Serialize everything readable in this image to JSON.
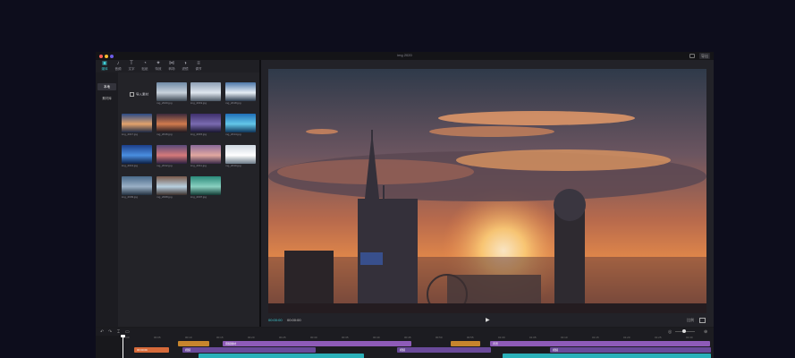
{
  "window": {
    "title": "img 2020",
    "traffic_lights": [
      "#ff5f57",
      "#febc2e",
      "#6c5ce7"
    ],
    "export_label": "导出"
  },
  "tabs": [
    {
      "icon": "media-icon",
      "glyph": "▣",
      "label": "媒体",
      "active": true
    },
    {
      "icon": "audio-icon",
      "glyph": "♪",
      "label": "音频",
      "active": false
    },
    {
      "icon": "text-icon",
      "glyph": "T",
      "label": "文字",
      "active": false
    },
    {
      "icon": "sticker-icon",
      "glyph": "◔",
      "label": "贴纸",
      "active": false
    },
    {
      "icon": "effects-icon",
      "glyph": "✦",
      "label": "特效",
      "active": false
    },
    {
      "icon": "transition-icon",
      "glyph": "⋈",
      "label": "转场",
      "active": false
    },
    {
      "icon": "filter-icon",
      "glyph": "◑",
      "label": "滤镜",
      "active": false
    },
    {
      "icon": "adjust-icon",
      "glyph": "≡",
      "label": "调节",
      "active": false
    }
  ],
  "sidebar": [
    {
      "label": "本地",
      "active": true
    },
    {
      "label": "素材库",
      "active": false
    }
  ],
  "filter_label": "导入素材",
  "thumbs": [
    {
      "cap": "img_2020.jpg",
      "colors": [
        "#6f8aa6",
        "#c9d2dc",
        "#3b4652"
      ]
    },
    {
      "cap": "img_2019.jpg",
      "colors": [
        "#8e9fb4",
        "#dfe6ee",
        "#4a5663"
      ]
    },
    {
      "cap": "img_2018.jpg",
      "colors": [
        "#4b76a8",
        "#e7eef5",
        "#2c3b4e"
      ]
    },
    {
      "cap": "img_2017.jpg",
      "colors": [
        "#2a4a86",
        "#e3a36b",
        "#1a2744"
      ]
    },
    {
      "cap": "img_2016.jpg",
      "colors": [
        "#3b2a3c",
        "#d17b4e",
        "#1c1620"
      ]
    },
    {
      "cap": "img_2015.jpg",
      "colors": [
        "#3d2f6b",
        "#7a6bb0",
        "#181630"
      ]
    },
    {
      "cap": "img_2014.jpg",
      "colors": [
        "#1f6fb8",
        "#63c7e8",
        "#0e3358"
      ]
    },
    {
      "cap": "img_2013.jpg",
      "colors": [
        "#1c3f8a",
        "#4a8ee0",
        "#0c1e44"
      ]
    },
    {
      "cap": "img_2012.jpg",
      "colors": [
        "#5a4a7a",
        "#d67a7a",
        "#2a2040"
      ]
    },
    {
      "cap": "img_2011.jpg",
      "colors": [
        "#8a6a9a",
        "#e2a8a0",
        "#3a2a48"
      ]
    },
    {
      "cap": "img_2010.jpg",
      "colors": [
        "#cfd8e2",
        "#ffffff",
        "#6a7a88"
      ]
    },
    {
      "cap": "img_2009.jpg",
      "colors": [
        "#4a6a8a",
        "#9ab0c6",
        "#22303e"
      ]
    },
    {
      "cap": "img_2008.jpg",
      "colors": [
        "#7a5a4a",
        "#b8d0e0",
        "#3a2e2a"
      ]
    },
    {
      "cap": "img_2007.jpg",
      "colors": [
        "#2a8a7a",
        "#8ad0c0",
        "#123a34"
      ]
    }
  ],
  "player": {
    "current_time": "00:00:00",
    "total_time": "00:00:00",
    "ratio": "比例"
  },
  "timeline": {
    "ticks": [
      "00:00",
      "00:05",
      "00:10",
      "00:15",
      "00:20",
      "00:25",
      "00:30",
      "00:35",
      "00:40",
      "00:45",
      "00:50",
      "00:55",
      "01:00",
      "01:05",
      "01:10",
      "01:15",
      "01:20",
      "01:25",
      "01:30"
    ],
    "clips": [
      {
        "label": "",
        "color": "#c7852d",
        "row": 0,
        "start": 92,
        "end": 127
      },
      {
        "label": "音频素材",
        "color": "#8e5bb8",
        "row": 0,
        "start": 142,
        "end": 353
      },
      {
        "label": "",
        "color": "#c7852d",
        "row": 0,
        "start": 397,
        "end": 430
      },
      {
        "label": "背景",
        "color": "#8e5bb8",
        "row": 0,
        "start": 441,
        "end": 687
      },
      {
        "label": "00:00:09",
        "color": "#d66a3a",
        "row": 1,
        "start": 43,
        "end": 82
      },
      {
        "label": "视频",
        "color": "#6a4a9a",
        "row": 1,
        "start": 97,
        "end": 246
      },
      {
        "label": "视频",
        "color": "#6a4a9a",
        "row": 1,
        "start": 337,
        "end": 442
      },
      {
        "label": "视频",
        "color": "#6a4a9a",
        "row": 1,
        "start": 508,
        "end": 688
      },
      {
        "label": "",
        "color": "#2ab0b8",
        "row": 2,
        "start": 115,
        "end": 300
      },
      {
        "label": "",
        "color": "#2ab0b8",
        "row": 2,
        "start": 455,
        "end": 688
      }
    ]
  }
}
